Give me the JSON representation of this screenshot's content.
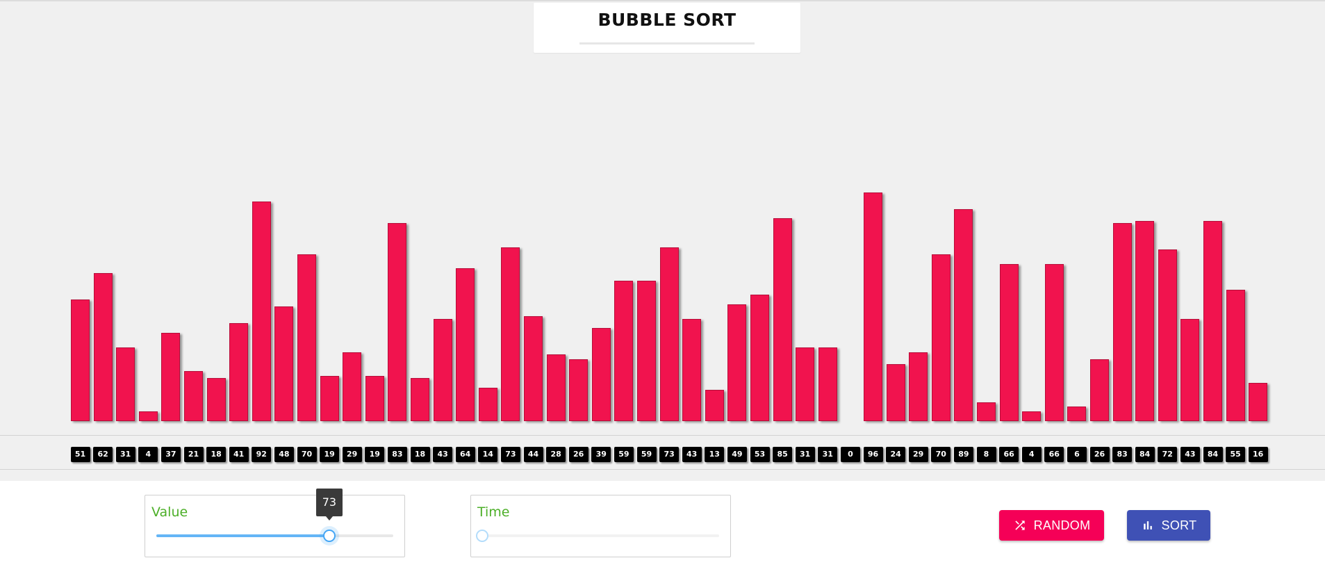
{
  "header": {
    "title": "BUBBLE SORT"
  },
  "array": {
    "values": [
      51,
      62,
      31,
      4,
      37,
      21,
      18,
      41,
      92,
      48,
      70,
      19,
      29,
      19,
      83,
      18,
      43,
      64,
      14,
      73,
      44,
      28,
      26,
      39,
      59,
      59,
      73,
      43,
      13,
      49,
      53,
      85,
      31,
      31,
      0,
      96,
      24,
      29,
      70,
      89,
      8,
      66,
      4,
      66,
      6,
      26,
      83,
      84,
      72,
      43,
      84,
      55,
      16
    ],
    "bar_color": "#f1134e"
  },
  "controls": {
    "value_slider": {
      "label": "Value",
      "value": 73,
      "max": 100
    },
    "time_slider": {
      "label": "Time",
      "value": 0,
      "max": 100
    },
    "random_button": {
      "label": "RANDOM",
      "icon": "shuffle-icon",
      "color": "#f50057"
    },
    "sort_button": {
      "label": "SORT",
      "icon": "bar-chart-icon",
      "color": "#3f51b5"
    }
  },
  "colors": {
    "accent_green": "#4caf28",
    "slider_blue": "#42a5f5"
  }
}
